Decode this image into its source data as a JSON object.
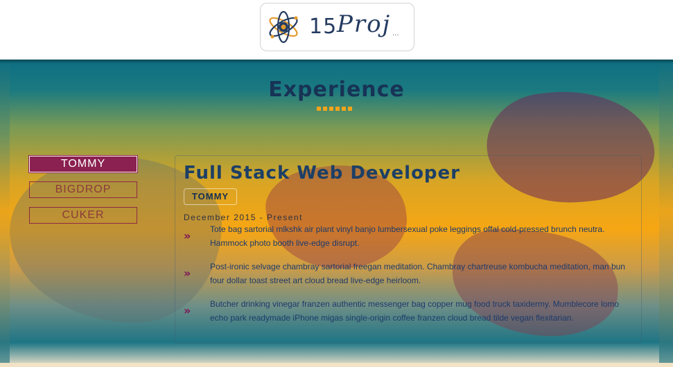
{
  "header": {
    "logo": {
      "number": "15",
      "word": "Proj",
      "dots": "..."
    }
  },
  "experience": {
    "title": "Experience",
    "tabs": [
      {
        "label": "TOMMY",
        "active": true
      },
      {
        "label": "BIGDROP",
        "active": false
      },
      {
        "label": "CUKER",
        "active": false
      }
    ],
    "job": {
      "title": "Full Stack Web Developer",
      "company": "TOMMY",
      "date": "December 2015 - Present",
      "bullets": [
        "Tote bag sartorial mlkshk air plant vinyl banjo lumbersexual poke leggings offal cold-pressed brunch neutra. Hammock photo booth live-edge disrupt.",
        "Post-ironic selvage chambray sartorial freegan meditation. Chambray chartreuse kombucha meditation, man bun four dollar toast street art cloud bread live-edge heirloom.",
        "Butcher drinking vinegar franzen authentic messenger bag copper mug food truck taxidermy. Mumblecore lomo echo park readymade iPhone migas single-origin coffee franzen cloud bread tilde vegan flexitarian."
      ],
      "bullet_icon": "»"
    }
  },
  "colors": {
    "accent": "#8b2150",
    "title": "#173356",
    "underline": "#f2a41a"
  }
}
